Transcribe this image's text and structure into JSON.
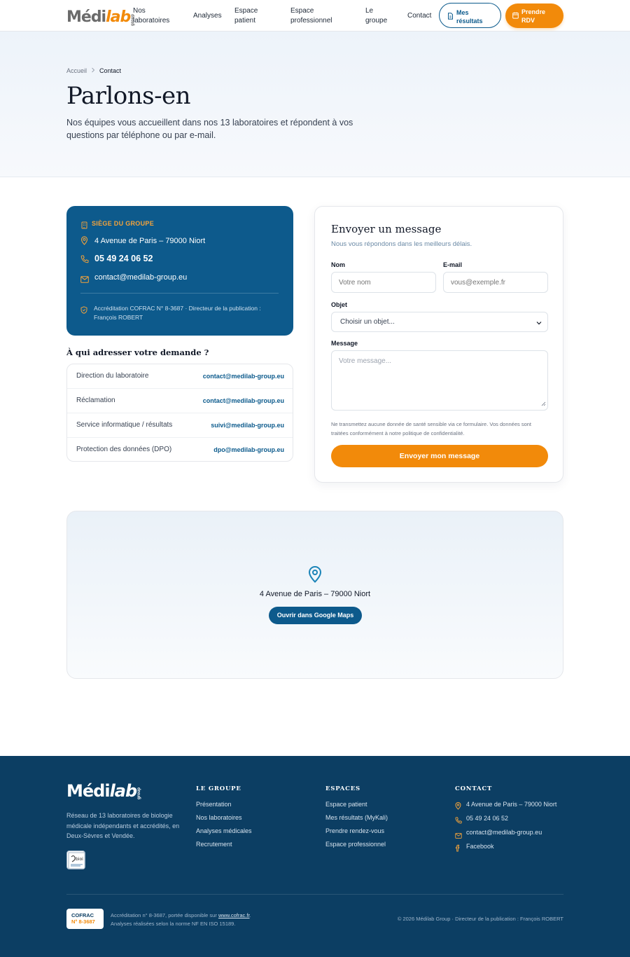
{
  "brand": {
    "logo_main": "Médi",
    "logo_accent": "lab",
    "logo_small": "group"
  },
  "nav": {
    "items": [
      {
        "label_line1": "Nos",
        "label_line2": "laboratoires"
      },
      {
        "label_line1": "Analyses",
        "label_line2": ""
      },
      {
        "label_line1": "Espace",
        "label_line2": "patient"
      },
      {
        "label_line1": "Espace",
        "label_line2": "professionnel"
      },
      {
        "label_line1": "Le",
        "label_line2": "groupe"
      },
      {
        "label_line1": "Contact",
        "label_line2": ""
      }
    ],
    "results_button": {
      "line1": "Mes",
      "line2": "résultats",
      "icon": "document-icon"
    },
    "rdv_button": {
      "line1": "Prendre",
      "line2": "RDV",
      "icon": "calendar-icon"
    }
  },
  "hero": {
    "breadcrumb_home": "Accueil",
    "breadcrumb_current": "Contact",
    "title": "Parlons-en",
    "subtitle": "Nos équipes vous accueillent dans nos 13 laboratoires et répondent à vos questions par téléphone ou par e-mail."
  },
  "siege": {
    "label": "SIÈGE DU GROUPE",
    "address": "4 Avenue de Paris – 79000 Niort",
    "phone": "05 49 24 06 52",
    "email": "contact@medilab-group.eu",
    "accreditation": "Accréditation COFRAC N° 8-3687 · Directeur de la publication : François ROBERT",
    "colors": {
      "background": "#0d5a8c",
      "label": "#f3a33b"
    }
  },
  "directory": {
    "title": "À qui adresser votre demande ?",
    "rows": [
      {
        "label": "Direction du laboratoire",
        "email": "contact@medilab-group.eu"
      },
      {
        "label": "Réclamation",
        "email": "contact@medilab-group.eu"
      },
      {
        "label": "Service informatique / résultats",
        "email": "suivi@medilab-group.eu"
      },
      {
        "label": "Protection des données (DPO)",
        "email": "dpo@medilab-group.eu"
      }
    ]
  },
  "form": {
    "title": "Envoyer un message",
    "subtitle": "Nous vous répondons dans les meilleurs délais.",
    "name_label": "Nom",
    "name_placeholder": "Votre nom",
    "email_label": "E-mail",
    "email_placeholder": "vous@exemple.fr",
    "subject_label": "Objet",
    "subject_selected": "Choisir un objet...",
    "message_label": "Message",
    "message_placeholder": "Votre message...",
    "note": "Ne transmettez aucune donnée de santé sensible via ce formulaire. Vos données sont traitées conformément à notre politique de confidentialité.",
    "submit": "Envoyer mon message"
  },
  "map": {
    "address": "4 Avenue de Paris – 79000 Niort",
    "button": "Ouvrir dans Google Maps"
  },
  "footer": {
    "description": "Réseau de 13 laboratoires de biologie médicale indépendants et accrédités, en Deux-Sèvres et Vendée.",
    "badge_text": "bioi",
    "col_groupe": {
      "title": "LE GROUPE",
      "links": [
        "Présentation",
        "Nos laboratoires",
        "Analyses médicales",
        "Recrutement"
      ]
    },
    "col_espaces": {
      "title": "ESPACES",
      "links": [
        "Espace patient",
        "Mes résultats (MyKali)",
        "Prendre rendez-vous",
        "Espace professionnel"
      ]
    },
    "col_contact": {
      "title": "CONTACT",
      "address": "4 Avenue de Paris – 79000 Niort",
      "phone": "05 49 24 06 52",
      "email": "contact@medilab-group.eu",
      "facebook": "Facebook"
    },
    "cofrac_line1": "COFRAC",
    "cofrac_line2": "N° 8-3687",
    "accr_prefix": "Accréditation n° 8-3687, portée disponible sur ",
    "accr_link": "www.cofrac.fr",
    "accr_suffix": ".",
    "accr_line2": "Analyses réalisées selon la norme NF EN ISO 15189.",
    "copyright": "© 2026 Médilab Group · Directeur de la publication : François ROBERT"
  },
  "colors": {
    "primary": "#0d5a8c",
    "accent": "#f28a0a",
    "footer_bg": "#0c3e63"
  }
}
